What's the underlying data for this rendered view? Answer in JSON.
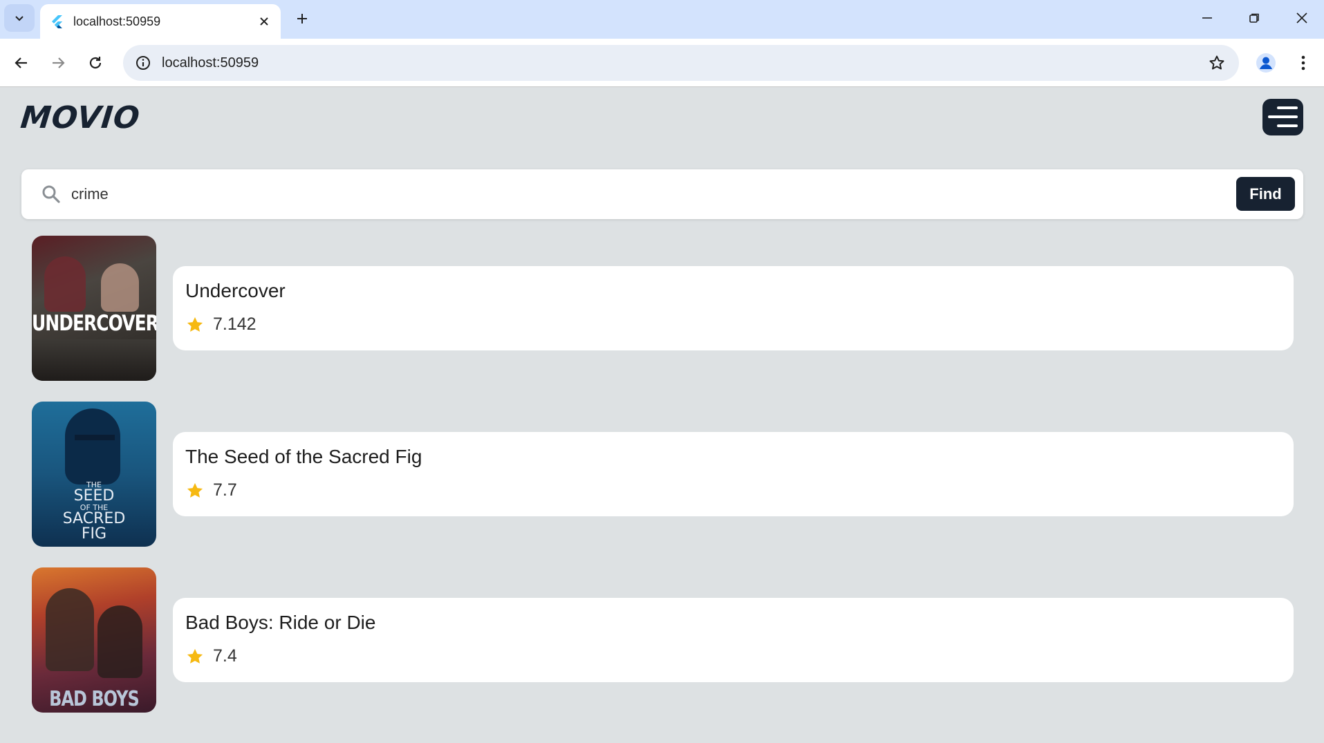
{
  "browser": {
    "tab_title": "localhost:50959",
    "url": "localhost:50959"
  },
  "app": {
    "logo": "MOVIO",
    "search": {
      "query": "crime",
      "button_label": "Find"
    },
    "results": [
      {
        "title": "Undercover",
        "rating": "7.142",
        "poster_text": "UNDERCOVER",
        "poster_colors": [
          "#4a4540",
          "#2a2622"
        ]
      },
      {
        "title": "The Seed of the Sacred Fig",
        "rating": "7.7",
        "poster_text_lines": [
          "THE",
          "SEED",
          "OF THE",
          "SACRED",
          "FIG"
        ],
        "poster_colors": [
          "#1f6e9a",
          "#0e3050"
        ]
      },
      {
        "title": "Bad Boys: Ride or Die",
        "rating": "7.4",
        "poster_text": "BAD BOYS",
        "poster_colors": [
          "#b0402a",
          "#3a1a2a"
        ]
      }
    ]
  },
  "colors": {
    "accent_dark": "#172231",
    "star": "#f6b912",
    "background": "#dde1e3"
  },
  "icons": [
    "chevron-down-icon",
    "flutter-icon",
    "close-icon",
    "plus-icon",
    "minimize-icon",
    "restore-icon",
    "back-icon",
    "forward-icon",
    "reload-icon",
    "info-icon",
    "star-outline-icon",
    "profile-icon",
    "kebab-icon",
    "menu-icon",
    "search-icon",
    "star-icon"
  ]
}
